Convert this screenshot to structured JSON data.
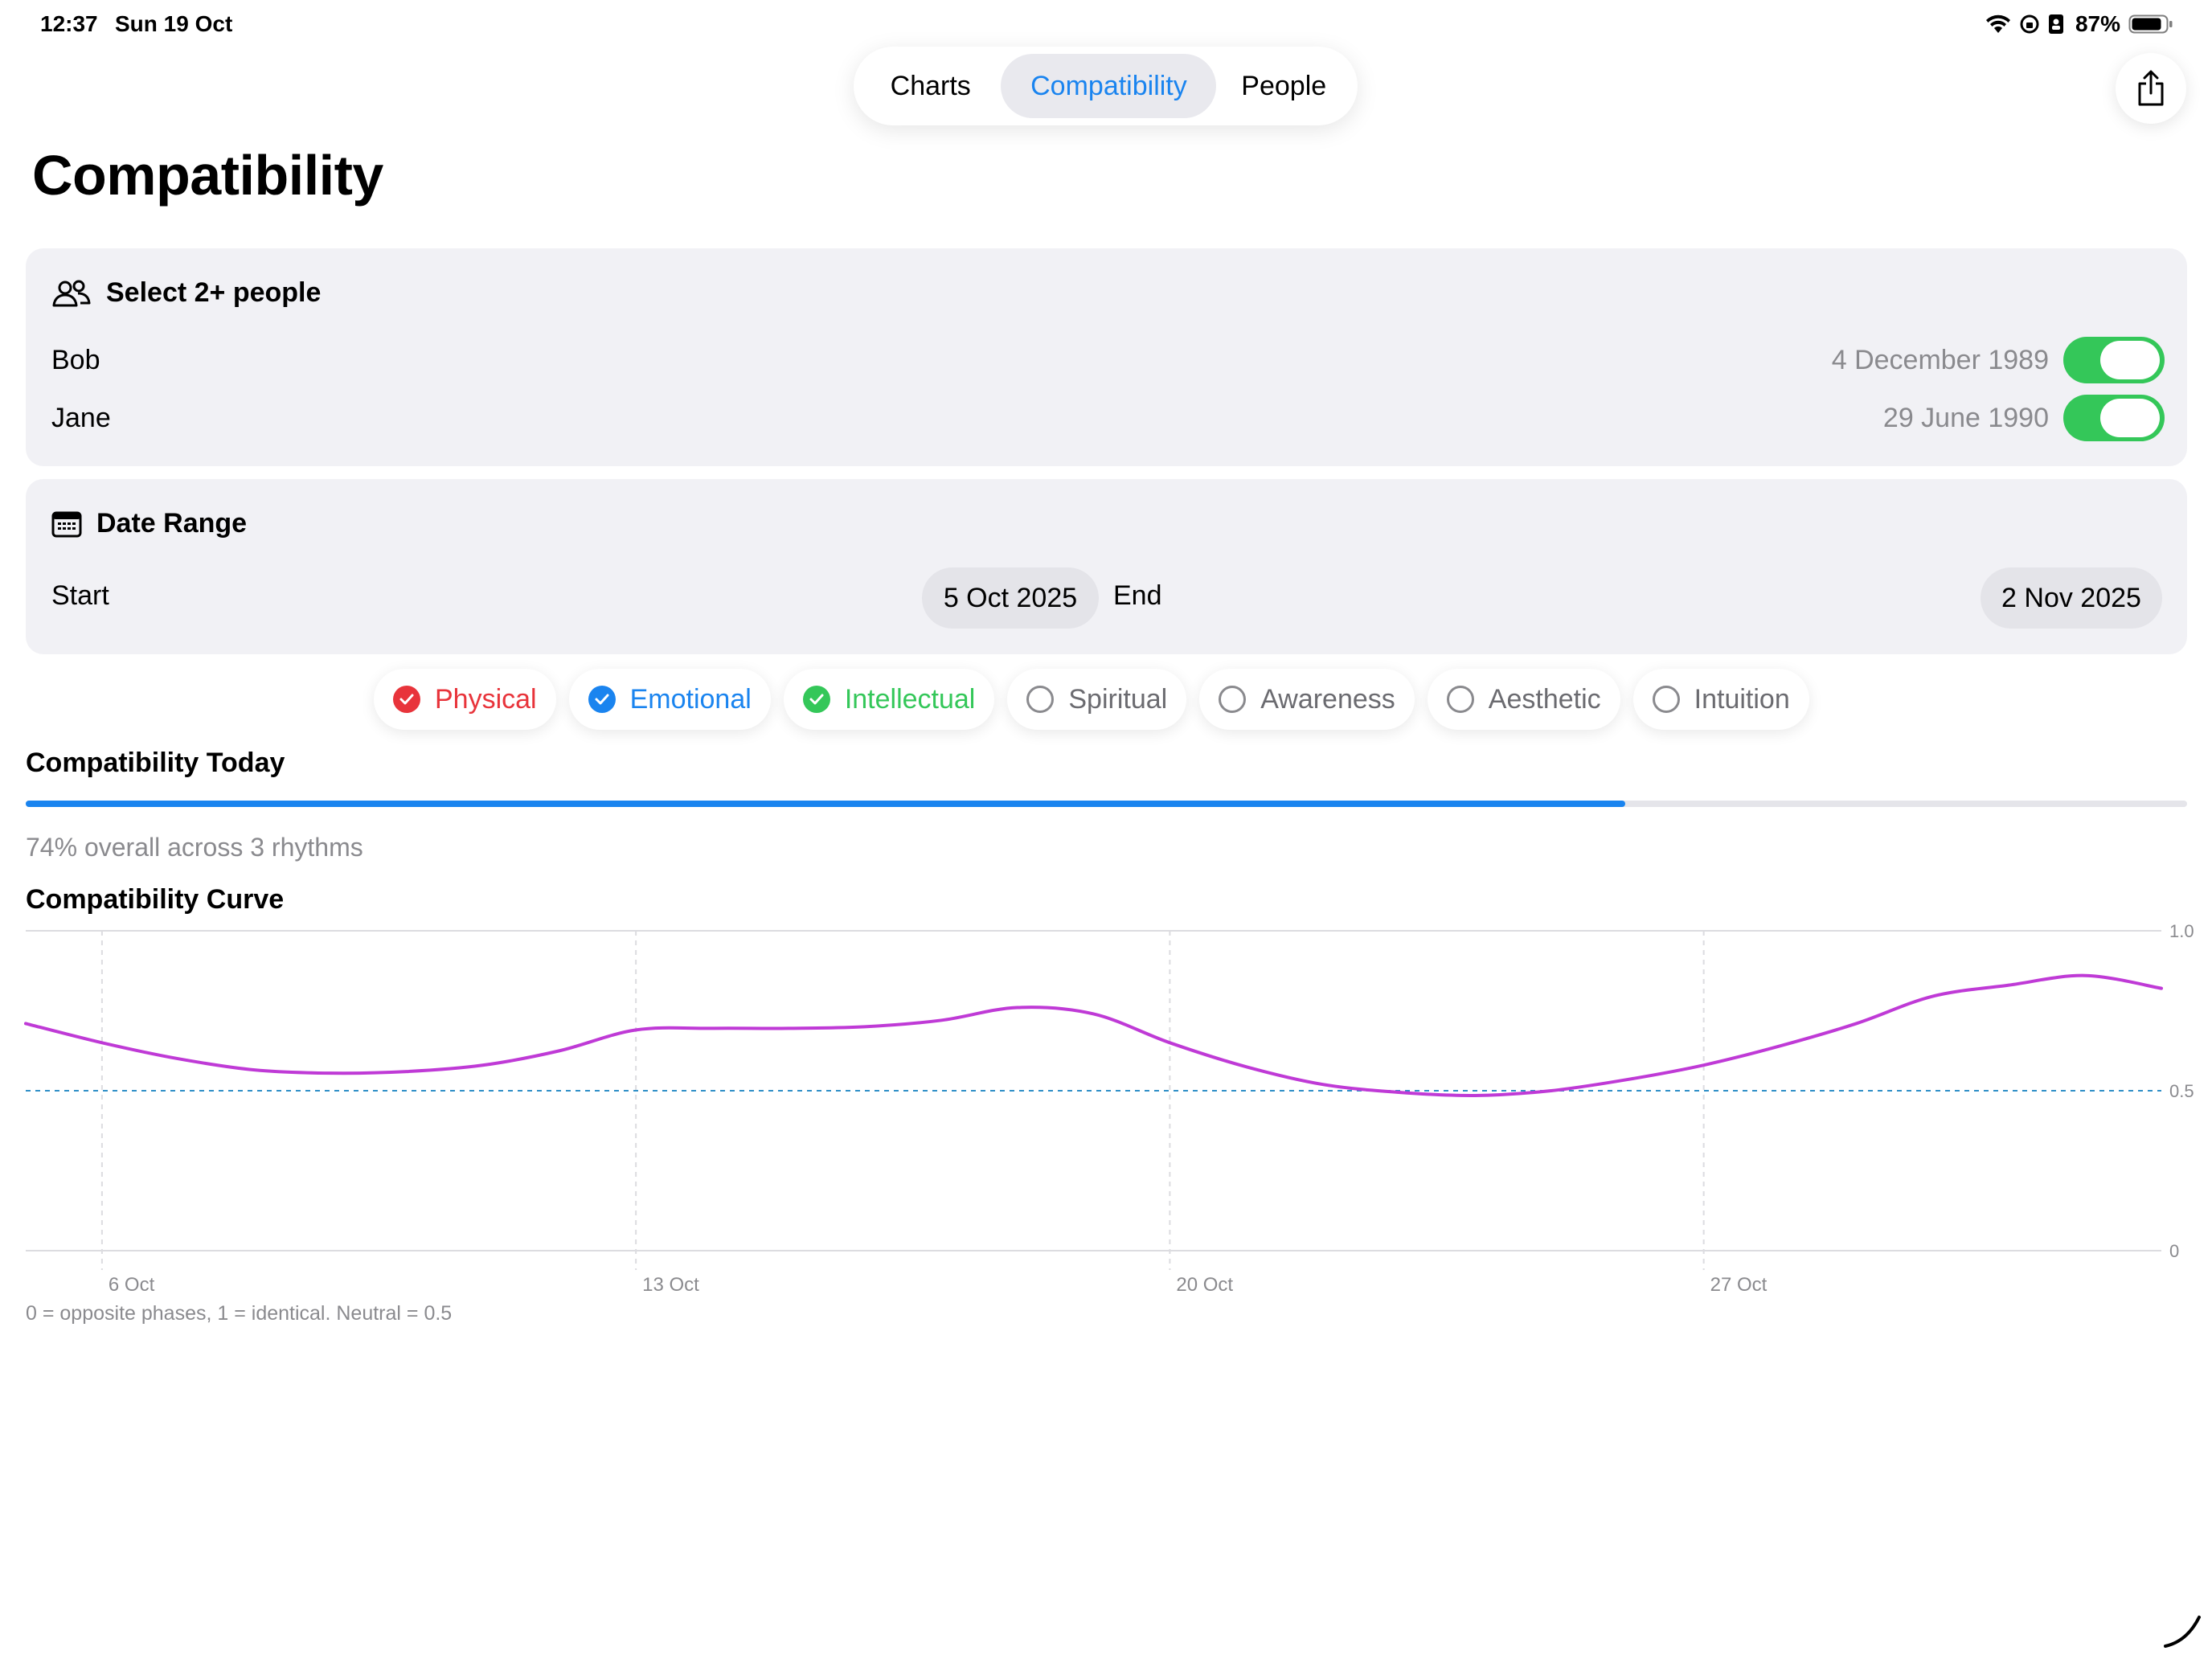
{
  "status": {
    "time": "12:37",
    "date": "Sun 19 Oct",
    "battery": "87%"
  },
  "tabs": [
    {
      "label": "Charts",
      "selected": false
    },
    {
      "label": "Compatibility",
      "selected": true
    },
    {
      "label": "People",
      "selected": false
    }
  ],
  "share_icon": "share-icon",
  "page_title": "Compatibility",
  "people_card": {
    "heading": "Select 2+ people",
    "people": [
      {
        "name": "Bob",
        "dob": "4 December 1989",
        "enabled": true
      },
      {
        "name": "Jane",
        "dob": "29 June 1990",
        "enabled": true
      }
    ]
  },
  "range_card": {
    "heading": "Date Range",
    "start_label": "Start",
    "start_value": "5 Oct 2025",
    "end_label": "End",
    "end_value": "2 Nov 2025"
  },
  "rhythms": [
    {
      "label": "Physical",
      "checked": true,
      "color": "#e8343b"
    },
    {
      "label": "Emotional",
      "checked": true,
      "color": "#1a84ef"
    },
    {
      "label": "Intellectual",
      "checked": true,
      "color": "#34c759"
    },
    {
      "label": "Spiritual",
      "checked": false,
      "color": "#6b6b70"
    },
    {
      "label": "Awareness",
      "checked": false,
      "color": "#6b6b70"
    },
    {
      "label": "Aesthetic",
      "checked": false,
      "color": "#6b6b70"
    },
    {
      "label": "Intuition",
      "checked": false,
      "color": "#6b6b70"
    }
  ],
  "today": {
    "title": "Compatibility Today",
    "overall": 0.74,
    "overall_text": "74% overall across 3 rhythms"
  },
  "curve": {
    "title": "Compatibility Curve",
    "note": "0 = opposite phases, 1 = identical. Neutral = 0.5"
  },
  "chart_data": {
    "type": "line",
    "x_ticks": [
      "6 Oct",
      "13 Oct",
      "20 Oct",
      "27 Oct"
    ],
    "y_ticks": [
      "1.0",
      "0.5",
      "0"
    ],
    "ylim": [
      0,
      1
    ],
    "xlim": [
      "5 Oct 2025",
      "2 Nov 2025"
    ],
    "reference_line": 0.5,
    "series": [
      {
        "color": "#bf3ad6",
        "x": [
          "5 Oct",
          "6 Oct",
          "7 Oct",
          "8 Oct",
          "9 Oct",
          "10 Oct",
          "11 Oct",
          "12 Oct",
          "13 Oct",
          "14 Oct",
          "15 Oct",
          "16 Oct",
          "17 Oct",
          "18 Oct",
          "19 Oct",
          "20 Oct",
          "21 Oct",
          "22 Oct",
          "23 Oct",
          "24 Oct",
          "25 Oct",
          "26 Oct",
          "27 Oct",
          "28 Oct",
          "29 Oct",
          "30 Oct",
          "31 Oct",
          "1 Nov",
          "2 Nov"
        ],
        "values": [
          0.71,
          0.65,
          0.6,
          0.565,
          0.555,
          0.56,
          0.58,
          0.625,
          0.69,
          0.695,
          0.695,
          0.7,
          0.72,
          0.76,
          0.74,
          0.65,
          0.575,
          0.52,
          0.495,
          0.485,
          0.5,
          0.535,
          0.58,
          0.64,
          0.71,
          0.795,
          0.83,
          0.86,
          0.82
        ]
      }
    ]
  }
}
